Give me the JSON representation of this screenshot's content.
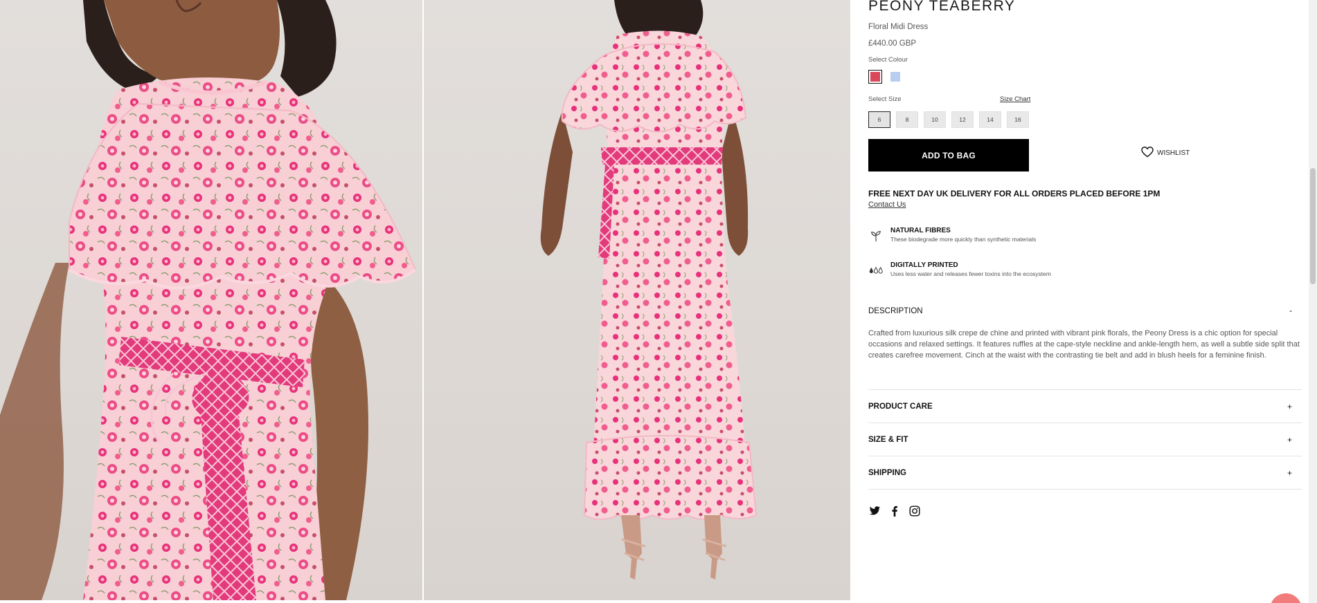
{
  "product": {
    "brand": "PEONY TEABERRY",
    "name": "Floral Midi Dress",
    "price": "£440.00 GBP"
  },
  "colour": {
    "label": "Select Colour",
    "options": [
      {
        "name": "red-pink",
        "hex": "#d9475a",
        "selected": true
      },
      {
        "name": "light-blue",
        "hex": "#b9cdf0",
        "selected": false
      }
    ]
  },
  "size": {
    "label": "Select Size",
    "chart_link": "Size Chart",
    "options": [
      "6",
      "8",
      "10",
      "12",
      "14",
      "16"
    ],
    "selected": "6"
  },
  "actions": {
    "add_to_bag": "ADD TO BAG",
    "wishlist": "WISHLIST"
  },
  "delivery": {
    "headline": "FREE NEXT DAY UK DELIVERY FOR ALL ORDERS PLACED BEFORE 1PM",
    "contact": "Contact Us"
  },
  "features": [
    {
      "icon": "plant-icon",
      "title": "NATURAL FIBRES",
      "description": "These biodegrade more quickly than synthetic materials"
    },
    {
      "icon": "water-drops-icon",
      "title": "DIGITALLY PRINTED",
      "description": "Uses less water and releases fewer toxins into the ecosystem"
    }
  ],
  "description": {
    "title": "DESCRIPTION",
    "toggle": "-",
    "body": "Crafted from luxurious silk crepe de chine and printed with vibrant pink florals, the Peony Dress is a chic option for special occasions and relaxed settings. It features ruffles at the cape-style neckline and ankle-length hem, as well a subtle side split that creates carefree movement. Cinch at the waist with the contrasting tie belt and add in blush heels for a feminine finish."
  },
  "accordions": [
    {
      "title": "PRODUCT CARE",
      "toggle": "+"
    },
    {
      "title": "SIZE & FIT",
      "toggle": "+"
    },
    {
      "title": "SHIPPING",
      "toggle": "+"
    }
  ],
  "social": [
    "twitter-icon",
    "facebook-icon",
    "instagram-icon"
  ],
  "colors": {
    "accent_pink": "#e8317a",
    "button_black": "#000000",
    "background_photo": "#ddd8d4"
  }
}
